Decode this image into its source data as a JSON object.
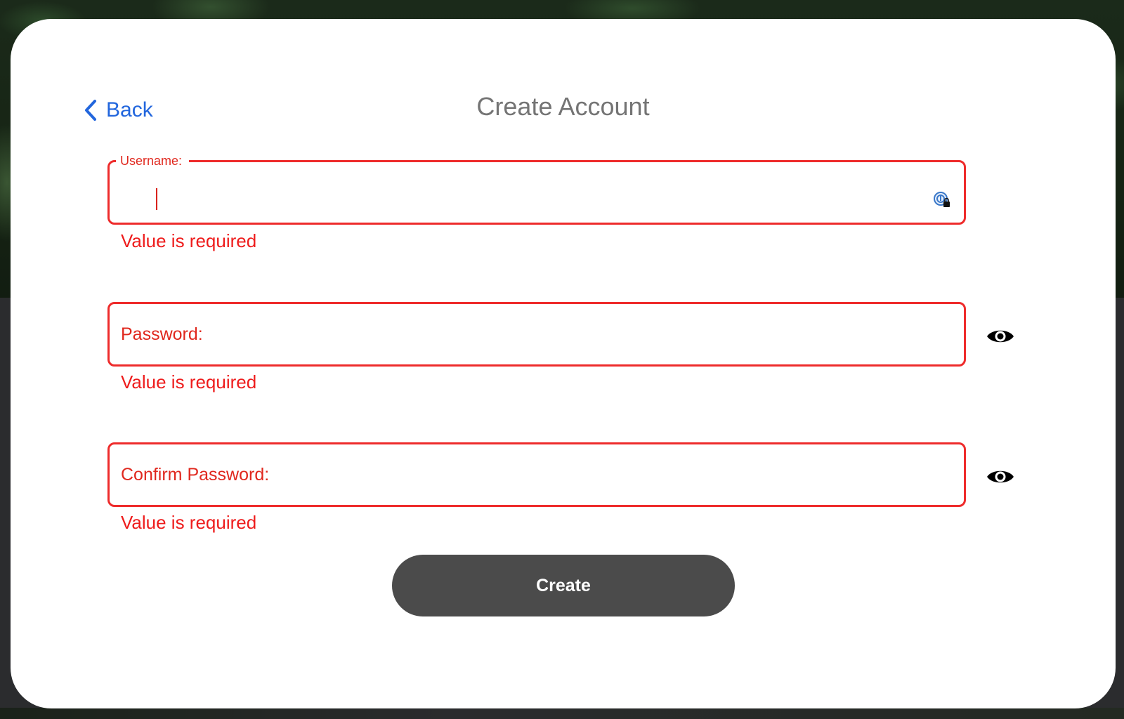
{
  "header": {
    "back_label": "Back",
    "title": "Create Account"
  },
  "form": {
    "username": {
      "label": "Username:",
      "value": "",
      "error": "Value is required",
      "focused": true,
      "password_manager_icon": "password-manager-lock-icon"
    },
    "password": {
      "label": "Password:",
      "value": "",
      "error": "Value is required",
      "visibility_icon": "eye-icon"
    },
    "confirm_password": {
      "label": "Confirm Password:",
      "value": "",
      "error": "Value is required",
      "visibility_icon": "eye-icon"
    },
    "submit_label": "Create"
  },
  "colors": {
    "accent_link": "#2266dd",
    "error": "#ee2b2b",
    "button_bg": "#4b4b4b",
    "title_text": "#747474"
  }
}
